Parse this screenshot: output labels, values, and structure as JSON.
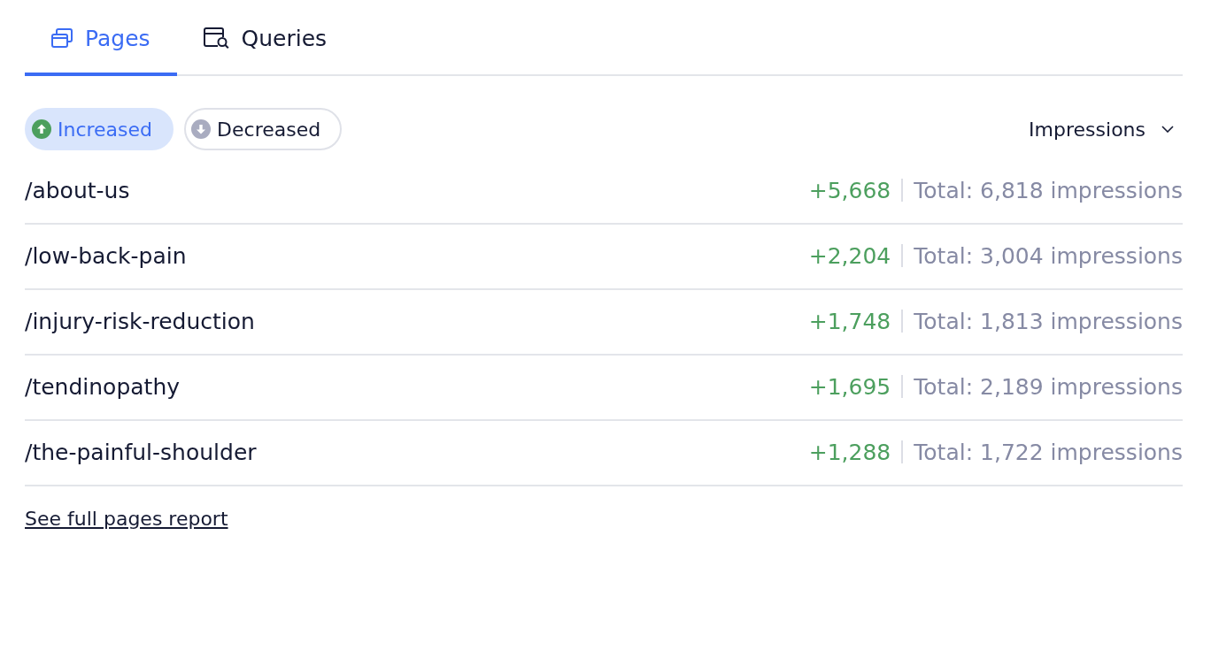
{
  "tabs": [
    {
      "label": "Pages",
      "selected": true
    },
    {
      "label": "Queries",
      "selected": false
    }
  ],
  "filters": [
    {
      "label": "Increased",
      "kind": "increase",
      "selected": true
    },
    {
      "label": "Decreased",
      "kind": "decrease",
      "selected": false
    }
  ],
  "sort_dropdown": {
    "value": "Impressions"
  },
  "rows": [
    {
      "page": "/about-us",
      "change": "+5,668",
      "total": "Total: 6,818 impressions"
    },
    {
      "page": "/low-back-pain",
      "change": "+2,204",
      "total": "Total: 3,004 impressions"
    },
    {
      "page": "/injury-risk-reduction",
      "change": "+1,748",
      "total": "Total: 1,813 impressions"
    },
    {
      "page": "/tendinopathy",
      "change": "+1,695",
      "total": "Total: 2,189 impressions"
    },
    {
      "page": "/the-painful-shoulder",
      "change": "+1,288",
      "total": "Total: 1,722 impressions"
    }
  ],
  "report_link": "See full pages report"
}
